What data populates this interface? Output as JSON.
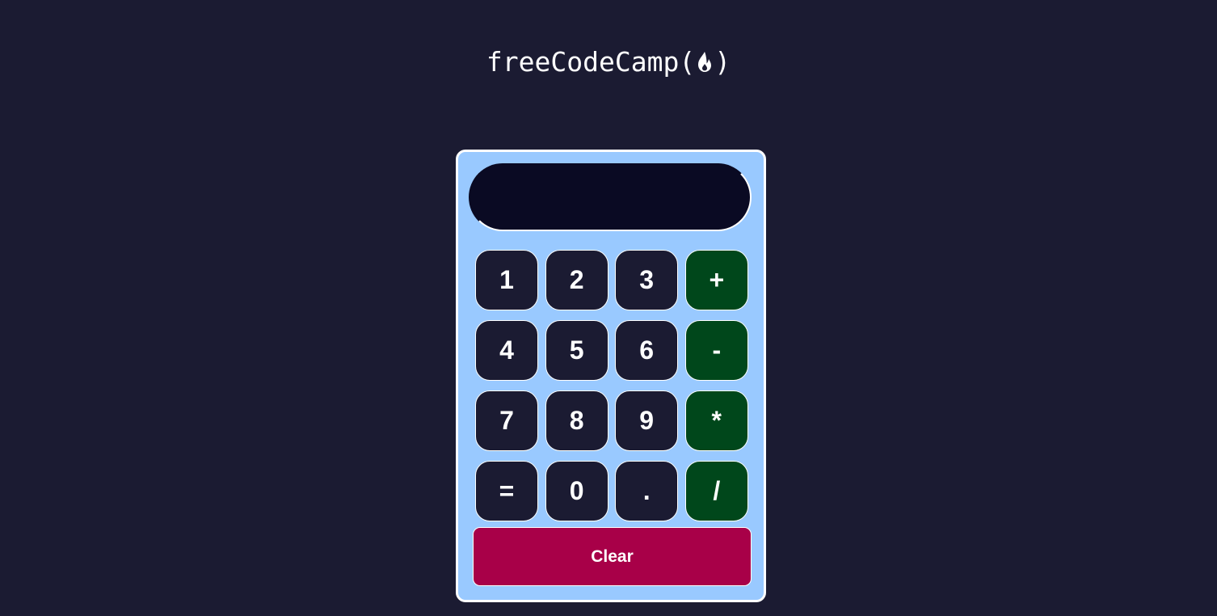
{
  "header": {
    "logo_text": "freeCodeCamp",
    "logo_open_paren": "(",
    "logo_close_paren": ")",
    "logo_icon": "flame-icon"
  },
  "calculator": {
    "display_value": "",
    "keys": [
      "1",
      "2",
      "3",
      "+",
      "4",
      "5",
      "6",
      "-",
      "7",
      "8",
      "9",
      "*",
      "=",
      "0",
      ".",
      "/"
    ],
    "clear_label": "Clear"
  },
  "colors": {
    "page_background": "#1b1b32",
    "calculator_background": "#99c9ff",
    "display_background": "#0a0a23",
    "number_key": "#1b1b32",
    "operator_key": "#00471b",
    "clear_button": "#a80048",
    "text": "#ffffff"
  }
}
